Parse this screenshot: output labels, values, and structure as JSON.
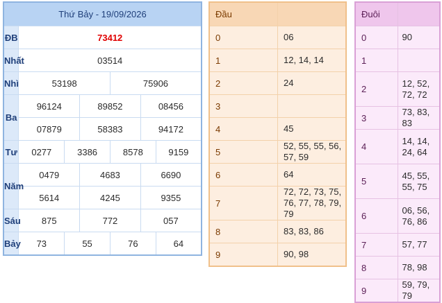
{
  "results": {
    "title": "Thứ Bảy - 19/09/2026",
    "rows": {
      "db": {
        "label": "ĐB",
        "values": [
          "73412"
        ]
      },
      "nhat": {
        "label": "Nhất",
        "values": [
          "03514"
        ]
      },
      "nhi": {
        "label": "Nhì",
        "values": [
          "53198",
          "75906"
        ]
      },
      "ba": {
        "label": "Ba",
        "values": [
          "96124",
          "89852",
          "08456",
          "07879",
          "58383",
          "94172"
        ]
      },
      "tu": {
        "label": "Tư",
        "values": [
          "0277",
          "3386",
          "8578",
          "9159"
        ]
      },
      "nam": {
        "label": "Năm",
        "values": [
          "0479",
          "4683",
          "6690",
          "5614",
          "4245",
          "9355"
        ]
      },
      "sau": {
        "label": "Sáu",
        "values": [
          "875",
          "772",
          "057"
        ]
      },
      "bay": {
        "label": "Bảy",
        "values": [
          "73",
          "55",
          "76",
          "64"
        ]
      }
    }
  },
  "dau": {
    "header": "Đầu",
    "rows": [
      {
        "num": "0",
        "vals": "06"
      },
      {
        "num": "1",
        "vals": "12, 14, 14"
      },
      {
        "num": "2",
        "vals": "24"
      },
      {
        "num": "3",
        "vals": ""
      },
      {
        "num": "4",
        "vals": "45"
      },
      {
        "num": "5",
        "vals": "52, 55, 55, 56, 57, 59"
      },
      {
        "num": "6",
        "vals": "64"
      },
      {
        "num": "7",
        "vals": "72, 72, 73, 75, 76, 77, 78, 79, 79"
      },
      {
        "num": "8",
        "vals": "83, 83, 86"
      },
      {
        "num": "9",
        "vals": "90, 98"
      }
    ]
  },
  "duoi": {
    "header": "Đuôi",
    "rows": [
      {
        "num": "0",
        "vals": "90"
      },
      {
        "num": "1",
        "vals": ""
      },
      {
        "num": "2",
        "vals": "12, 52, 72, 72"
      },
      {
        "num": "3",
        "vals": "73, 83, 83"
      },
      {
        "num": "4",
        "vals": "14, 14, 24, 64"
      },
      {
        "num": "5",
        "vals": "45, 55, 55, 75"
      },
      {
        "num": "6",
        "vals": "06, 56, 76, 86"
      },
      {
        "num": "7",
        "vals": "57, 77"
      },
      {
        "num": "8",
        "vals": "78, 98"
      },
      {
        "num": "9",
        "vals": "59, 79, 79"
      }
    ]
  }
}
